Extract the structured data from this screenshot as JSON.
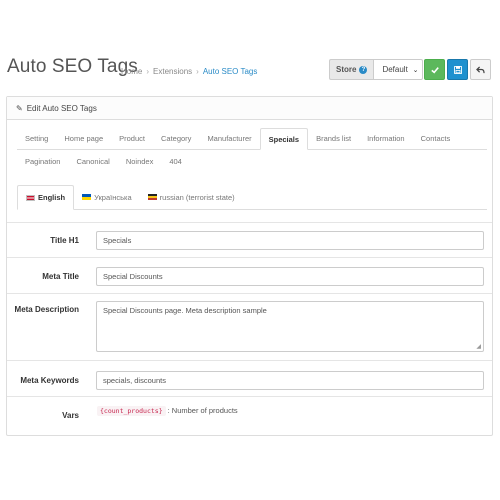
{
  "header": {
    "title": "Auto SEO Tags",
    "breadcrumb": [
      {
        "label": "Home"
      },
      {
        "label": "Extensions"
      },
      {
        "label": "Auto SEO Tags"
      }
    ],
    "breadcrumb_sep": "›",
    "store_label": "Store",
    "store_help_icon": "?",
    "store_value": "Default",
    "save_close_icon": "check-icon",
    "save_icon": "floppy-icon",
    "back_icon": "reply-icon"
  },
  "panel": {
    "heading": "Edit Auto SEO Tags"
  },
  "tabs": {
    "row1": [
      "Setting",
      "Home page",
      "Product",
      "Category",
      "Manufacturer",
      "Specials",
      "Brands list",
      "Information",
      "Contacts"
    ],
    "row2": [
      "Pagination",
      "Canonical",
      "Noindex",
      "404"
    ],
    "active": "Specials"
  },
  "languages": [
    {
      "label": "English",
      "flag": "flag-en",
      "active": true
    },
    {
      "label": "Українська",
      "flag": "flag-ua",
      "active": false
    },
    {
      "label": "russian (terrorist state)",
      "flag": "flag-ru",
      "active": false
    }
  ],
  "form": {
    "title_h1_label": "Title H1",
    "title_h1_value": "Specials",
    "meta_title_label": "Meta Title",
    "meta_title_value": "Special Discounts",
    "meta_description_label": "Meta Description",
    "meta_description_value": "Special Discounts page. Meta description sample",
    "meta_keywords_label": "Meta Keywords",
    "meta_keywords_value": "specials, discounts",
    "vars_label": "Vars",
    "vars_code": "{count_products}",
    "vars_desc": ": Number of products"
  },
  "colors": {
    "success": "#5cb85c",
    "primary": "#1e91cf",
    "link": "#2a8bc7"
  }
}
